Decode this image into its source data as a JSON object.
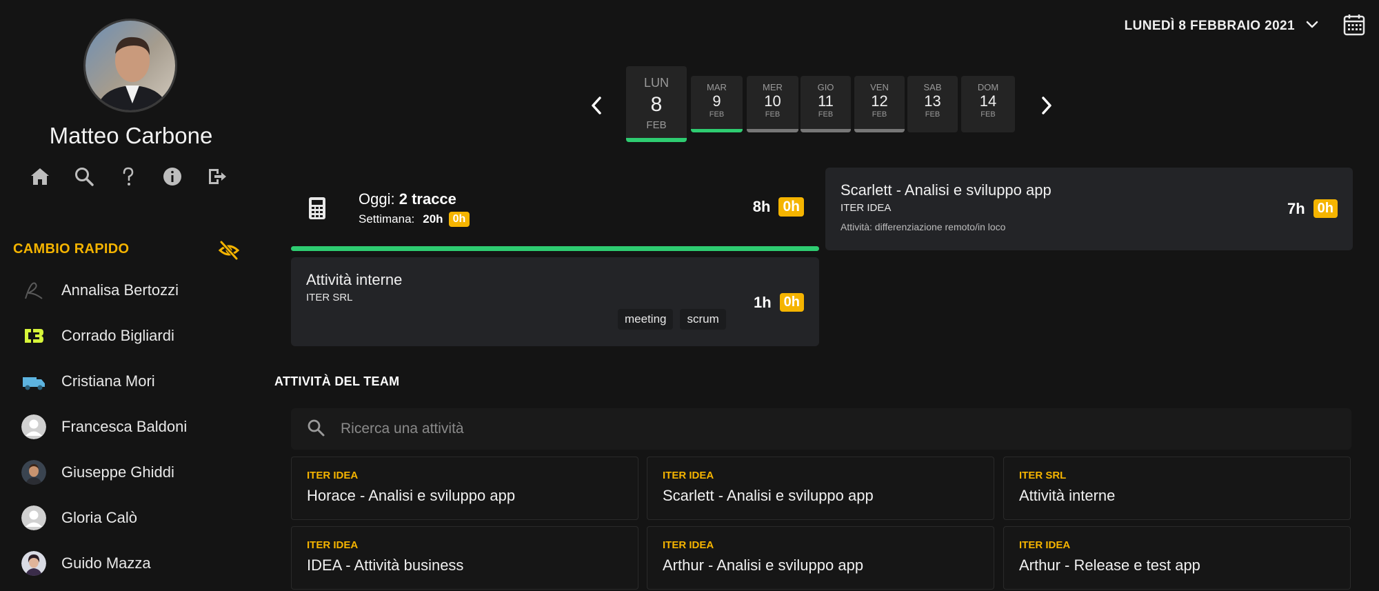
{
  "user": {
    "name": "Matteo Carbone"
  },
  "nav_icons": [
    "home-icon",
    "search-icon",
    "help-icon",
    "info-icon",
    "logout-icon"
  ],
  "quick_switch": {
    "title": "CAMBIO RAPIDO",
    "people": [
      {
        "name": "Annalisa Bertozzi",
        "avatar": "logo-outline"
      },
      {
        "name": "Corrado Bigliardi",
        "avatar": "logo-cb"
      },
      {
        "name": "Cristiana Mori",
        "avatar": "van"
      },
      {
        "name": "Francesca Baldoni",
        "avatar": "default"
      },
      {
        "name": "Giuseppe Ghiddi",
        "avatar": "photo"
      },
      {
        "name": "Gloria Calò",
        "avatar": "default"
      },
      {
        "name": "Guido Mazza",
        "avatar": "photo"
      }
    ]
  },
  "header": {
    "date": "LUNEDÌ 8 FEBBRAIO 2021"
  },
  "days": [
    {
      "name": "LUN",
      "num": "8",
      "month": "FEB",
      "selected": true,
      "bar": "#2ecc71"
    },
    {
      "name": "MAR",
      "num": "9",
      "month": "FEB",
      "bar": "#2ecc71"
    },
    {
      "name": "MER",
      "num": "10",
      "month": "FEB",
      "bar": "#777777"
    },
    {
      "name": "GIO",
      "num": "11",
      "month": "FEB",
      "bar": "#777777"
    },
    {
      "name": "VEN",
      "num": "12",
      "month": "FEB",
      "bar": "#777777"
    },
    {
      "name": "SAB",
      "num": "13",
      "month": "FEB",
      "bar": ""
    },
    {
      "name": "DOM",
      "num": "14",
      "month": "FEB",
      "bar": ""
    }
  ],
  "summary": {
    "today_label": "Oggi:",
    "today_value": "2 tracce",
    "week_label": "Settimana:",
    "week_hours": "20h",
    "week_badge": "0h",
    "hours": "8h",
    "badge": "0h",
    "progress_color": "#2ecc71"
  },
  "tracks": [
    {
      "title": "Scarlett - Analisi e sviluppo app",
      "client": "ITER IDEA",
      "note": "Attività: differenziazione remoto/in loco",
      "hours": "7h",
      "badge": "0h"
    },
    {
      "title": "Attività interne",
      "client": "ITER SRL",
      "tags": [
        "meeting",
        "scrum"
      ],
      "hours": "1h",
      "badge": "0h"
    }
  ],
  "team": {
    "title": "ATTIVITÀ DEL TEAM",
    "search_placeholder": "Ricerca una attività",
    "activities": [
      {
        "client": "ITER IDEA",
        "title": "Horace - Analisi e sviluppo app"
      },
      {
        "client": "ITER IDEA",
        "title": "Scarlett - Analisi e sviluppo app"
      },
      {
        "client": "ITER SRL",
        "title": "Attività interne"
      },
      {
        "client": "ITER IDEA",
        "title": "IDEA - Attività business"
      },
      {
        "client": "ITER IDEA",
        "title": "Arthur - Analisi e sviluppo app"
      },
      {
        "client": "ITER IDEA",
        "title": "Arthur - Release e test app"
      }
    ]
  },
  "colors": {
    "accent": "#f5b400",
    "success": "#2ecc71",
    "background": "#141414",
    "card": "#232427"
  }
}
